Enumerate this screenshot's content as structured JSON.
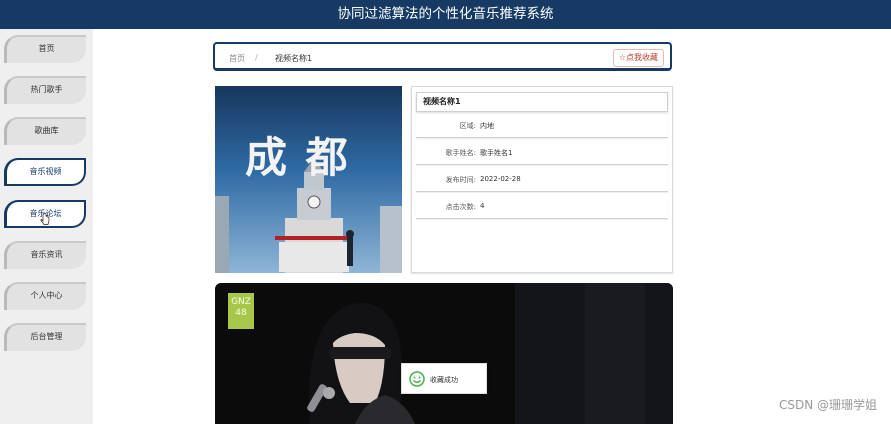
{
  "header": {
    "title": "协同过滤算法的个性化音乐推荐系统"
  },
  "sidebar": {
    "items": [
      {
        "label": "首页",
        "active": false
      },
      {
        "label": "热门歌手",
        "active": false
      },
      {
        "label": "歌曲库",
        "active": false
      },
      {
        "label": "音乐视频",
        "active": true
      },
      {
        "label": "音乐论坛",
        "active": true
      },
      {
        "label": "音乐资讯",
        "active": false
      },
      {
        "label": "个人中心",
        "active": false
      },
      {
        "label": "后台管理",
        "active": false
      }
    ]
  },
  "breadcrumb": {
    "home": "首页",
    "separator": "/",
    "current": "视频名称1"
  },
  "collect_button": {
    "icon": "star-icon",
    "label": "☆点我收藏"
  },
  "cover": {
    "text": "成 都"
  },
  "detail": {
    "title": "视频名称1",
    "rows": [
      {
        "label": "区域:",
        "value": "内地"
      },
      {
        "label": "歌手姓名:",
        "value": "歌手姓名1"
      },
      {
        "label": "发布时间:",
        "value": "2022-02-28"
      },
      {
        "label": "点击次数:",
        "value": "4"
      }
    ]
  },
  "video": {
    "logo": "GNZ 48"
  },
  "toast": {
    "icon": "smile-icon",
    "text": "收藏成功"
  },
  "watermark": "CSDN @珊珊学姐",
  "colors": {
    "header_bg": "#163a64",
    "accent": "#163a64",
    "collect": "#c0392b"
  }
}
